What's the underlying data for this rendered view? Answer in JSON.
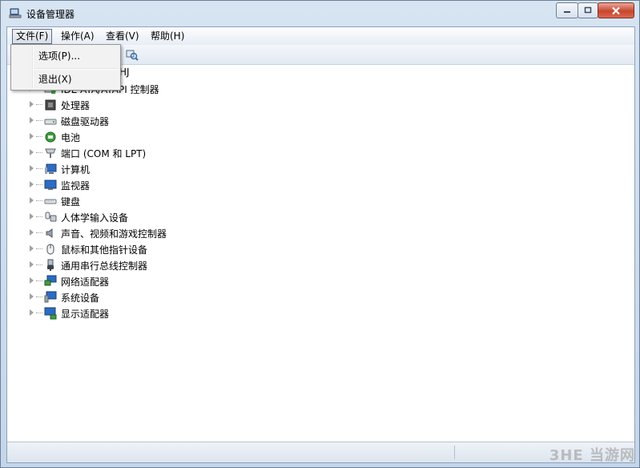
{
  "window": {
    "title": "设备管理器",
    "icon": "device-manager-icon"
  },
  "menubar": {
    "file": "文件(F)",
    "action": "操作(A)",
    "view": "查看(V)",
    "help": "帮助(H)"
  },
  "file_menu": {
    "options": "选项(P)...",
    "exit": "退出(X)"
  },
  "tree": {
    "root_suffix": "HJ",
    "items": [
      {
        "label": "IDE ATA/ATAPI 控制器",
        "icon": "ide-controller-icon"
      },
      {
        "label": "处理器",
        "icon": "processor-icon"
      },
      {
        "label": "磁盘驱动器",
        "icon": "disk-drive-icon"
      },
      {
        "label": "电池",
        "icon": "battery-icon"
      },
      {
        "label": "端口 (COM 和 LPT)",
        "icon": "port-icon"
      },
      {
        "label": "计算机",
        "icon": "computer-icon"
      },
      {
        "label": "监视器",
        "icon": "monitor-icon"
      },
      {
        "label": "键盘",
        "icon": "keyboard-icon"
      },
      {
        "label": "人体学输入设备",
        "icon": "hid-icon"
      },
      {
        "label": "声音、视频和游戏控制器",
        "icon": "sound-icon"
      },
      {
        "label": "鼠标和其他指针设备",
        "icon": "mouse-icon"
      },
      {
        "label": "通用串行总线控制器",
        "icon": "usb-icon"
      },
      {
        "label": "网络适配器",
        "icon": "network-adapter-icon"
      },
      {
        "label": "系统设备",
        "icon": "system-device-icon"
      },
      {
        "label": "显示适配器",
        "icon": "display-adapter-icon"
      }
    ]
  },
  "watermark": "3HE 当游网",
  "colors": {
    "title_bar": "#d7e4f2",
    "close_button": "#c8452e",
    "menu_border": "#5a6e8c"
  }
}
